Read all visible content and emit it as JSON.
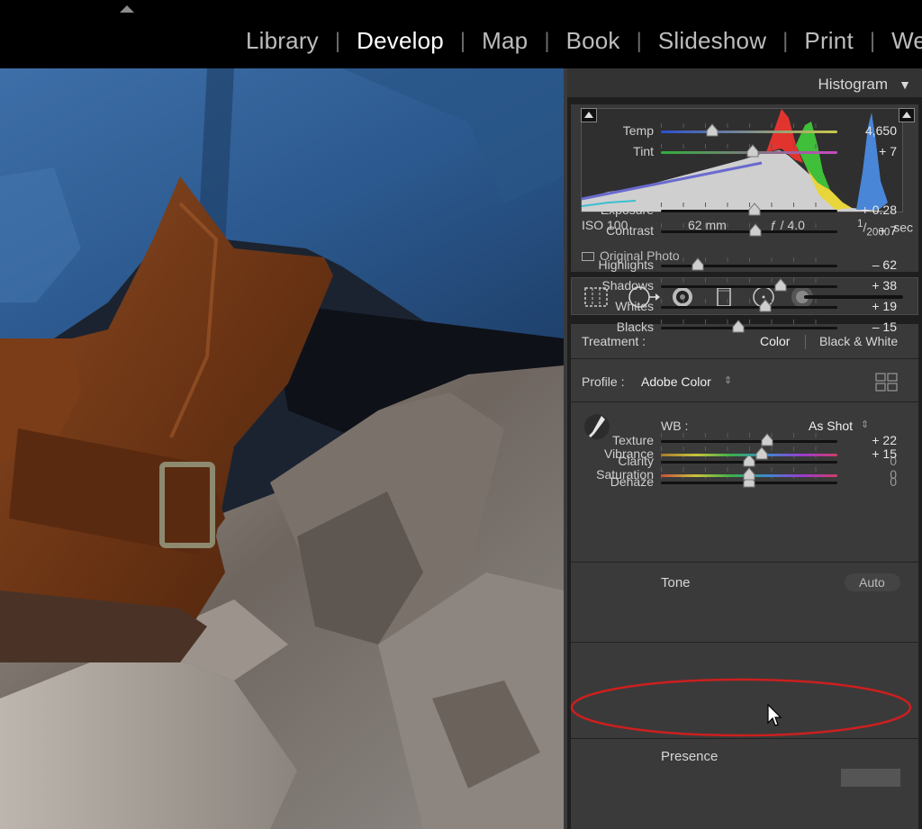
{
  "modules": {
    "library": "Library",
    "develop": "Develop",
    "map": "Map",
    "book": "Book",
    "slideshow": "Slideshow",
    "print": "Print",
    "web": "Web",
    "separator": "|"
  },
  "histogram": {
    "title": "Histogram",
    "toggle": "▼",
    "iso": "ISO 100",
    "focal_length": "62 mm",
    "aperture": "ƒ / 4.0",
    "shutter_num": "1",
    "shutter_den": "2000",
    "shutter_unit": "sec",
    "original_photo": "Original Photo"
  },
  "tools": [
    "crop-overlay-icon",
    "spot-removal-icon",
    "red-eye-icon",
    "graduated-filter-icon",
    "radial-filter-icon",
    "adjustment-brush-icon"
  ],
  "treatment": {
    "label": "Treatment :",
    "color": "Color",
    "bw": "Black & White"
  },
  "profile": {
    "label": "Profile :",
    "value": "Adobe Color",
    "stepper": "⇕"
  },
  "wb": {
    "label": "WB :",
    "value": "As Shot",
    "stepper": "⇕"
  },
  "sliders": {
    "temp": {
      "label": "Temp",
      "value": "4,650",
      "position": 0.29
    },
    "tint": {
      "label": "Tint",
      "value": "+ 7",
      "position": 0.52
    },
    "exposure": {
      "label": "Exposure",
      "value": "+ 0.28",
      "position": 0.53
    },
    "contrast": {
      "label": "Contrast",
      "value": "+ 7",
      "position": 0.535
    },
    "highlights": {
      "label": "Highlights",
      "value": "– 62",
      "position": 0.21
    },
    "shadows": {
      "label": "Shadows",
      "value": "+ 38",
      "position": 0.68
    },
    "whites": {
      "label": "Whites",
      "value": "+ 19",
      "position": 0.59
    },
    "blacks": {
      "label": "Blacks",
      "value": "– 15",
      "position": 0.44
    },
    "texture": {
      "label": "Texture",
      "value": "+ 22",
      "position": 0.6
    },
    "clarity": {
      "label": "Clarity",
      "value": "0",
      "position": 0.5
    },
    "dehaze": {
      "label": "Dehaze",
      "value": "0",
      "position": 0.5
    },
    "vibrance": {
      "label": "Vibrance",
      "value": "+ 15",
      "position": 0.57
    },
    "saturation": {
      "label": "Saturation",
      "value": "0",
      "position": 0.5
    }
  },
  "tone": {
    "title": "Tone",
    "auto": "Auto"
  },
  "presence": {
    "title": "Presence"
  },
  "colors": {
    "panel_bg": "#3a3a3a",
    "highlight_oval": "#cc1f1f",
    "active_module": "#ffffff"
  }
}
